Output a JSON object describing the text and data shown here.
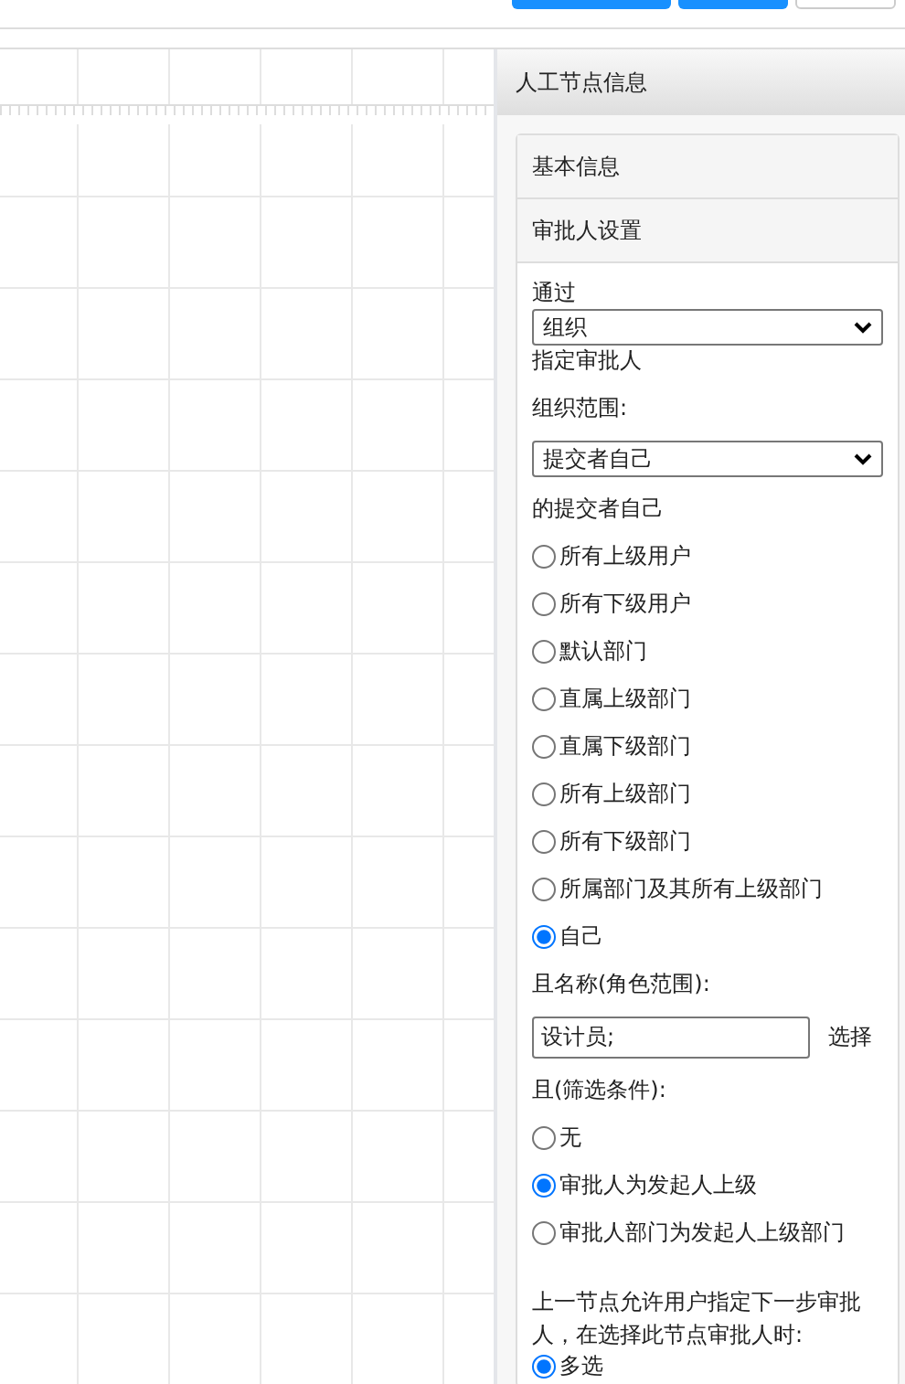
{
  "toolbar": {
    "buttons": [
      {
        "kind": "primary"
      },
      {
        "kind": "primary"
      },
      {
        "kind": "default"
      }
    ]
  },
  "panel": {
    "title": "人工节点信息",
    "sections": [
      {
        "label": "基本信息"
      },
      {
        "label": "审批人设置"
      }
    ]
  },
  "form": {
    "via_label": "通过",
    "via_select": "组织",
    "assign_label": "指定审批人",
    "scope_label": "组织范围:",
    "scope_select": "提交者自己",
    "scope_suffix": "的提交者自己",
    "scope_options": [
      {
        "label": "所有上级用户",
        "selected": false
      },
      {
        "label": "所有下级用户",
        "selected": false
      },
      {
        "label": "默认部门",
        "selected": false
      },
      {
        "label": "直属上级部门",
        "selected": false
      },
      {
        "label": "直属下级部门",
        "selected": false
      },
      {
        "label": "所有上级部门",
        "selected": false
      },
      {
        "label": "所有下级部门",
        "selected": false
      },
      {
        "label": "所属部门及其所有上级部门",
        "selected": false
      },
      {
        "label": "自己",
        "selected": true
      }
    ],
    "role_label": "且名称(角色范围):",
    "role_input": "设计员;",
    "role_pick": "选择",
    "filter_label": "且(筛选条件):",
    "filter_options": [
      {
        "label": "无",
        "selected": false
      },
      {
        "label": "审批人为发起人上级",
        "selected": true
      },
      {
        "label": "审批人部门为发起人上级部门",
        "selected": false
      }
    ],
    "next_label": "上一节点允许用户指定下一步审批人，在选择此节点审批人时:",
    "mode_options": [
      {
        "label": "多选",
        "selected": true
      }
    ]
  }
}
